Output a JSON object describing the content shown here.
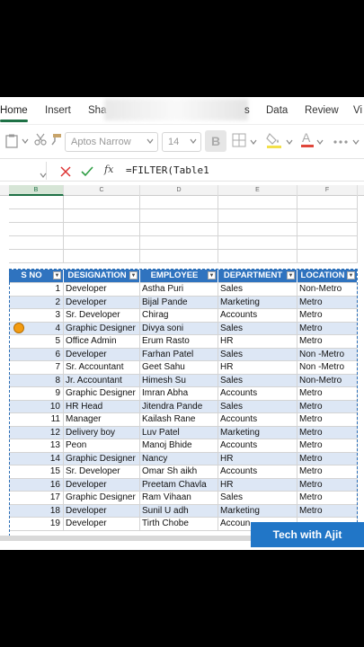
{
  "ribbon": {
    "tabs": [
      {
        "label": "Home",
        "active": true
      },
      {
        "label": "Insert"
      },
      {
        "label": "Sha"
      },
      {
        "label": "s"
      },
      {
        "label": "Data"
      },
      {
        "label": "Review"
      },
      {
        "label": "Vi"
      }
    ]
  },
  "toolbar": {
    "font_name": "Aptos Narrow",
    "font_size": "14",
    "bold_label": "B"
  },
  "formula_bar": {
    "formula": "=FILTER(Table1"
  },
  "grid": {
    "column_letters": [
      "B",
      "C",
      "D",
      "E",
      "F"
    ],
    "headers": [
      "S NO",
      "DESIGNATION",
      "EMPLOYEE",
      "DEPARTMENT",
      "LOCATION"
    ],
    "rows": [
      [
        "1",
        "Developer",
        "Astha Puri",
        "Sales",
        "Non-Metro"
      ],
      [
        "2",
        "Developer",
        "Bijal Pande",
        "Marketing",
        "Metro"
      ],
      [
        "3",
        "Sr. Developer",
        "Chirag",
        "Accounts",
        "Metro"
      ],
      [
        "4",
        "Graphic Designer",
        "Divya soni",
        "Sales",
        "Metro"
      ],
      [
        "5",
        "Office Admin",
        "Erum Rasto",
        "HR",
        "Metro"
      ],
      [
        "6",
        "Developer",
        "Farhan Patel",
        "Sales",
        "Non -Metro"
      ],
      [
        "7",
        "Sr. Accountant",
        "Geet Sahu",
        "HR",
        "Non -Metro"
      ],
      [
        "8",
        "Jr. Accountant",
        "Himesh Su",
        "Sales",
        "Non-Metro"
      ],
      [
        "9",
        "Graphic Designer",
        "Imran Abha",
        "Accounts",
        "Metro"
      ],
      [
        "10",
        "HR Head",
        "Jitendra Pande",
        "Sales",
        "Metro"
      ],
      [
        "11",
        "Manager",
        "Kailash Rane",
        "Accounts",
        "Metro"
      ],
      [
        "12",
        "Delivery boy",
        "Luv Patel",
        "Marketing",
        "Metro"
      ],
      [
        "13",
        "Peon",
        "Manoj Bhide",
        "Accounts",
        "Metro"
      ],
      [
        "14",
        "Graphic Designer",
        "Nancy",
        "HR",
        "Metro"
      ],
      [
        "15",
        "Sr. Developer",
        "Omar Sh aikh",
        "Accounts",
        "Metro"
      ],
      [
        "16",
        "Developer",
        "Preetam Chavla",
        "HR",
        "Metro"
      ],
      [
        "17",
        "Graphic Designer",
        "Ram Vihaan",
        "Sales",
        "Metro"
      ],
      [
        "18",
        "Developer",
        "Sunil U adh",
        "Marketing",
        "Metro"
      ],
      [
        "19",
        "Developer",
        "Tirth Chobe",
        "Accoun",
        ""
      ]
    ]
  },
  "watermark": {
    "text": "Tech with Ajit"
  },
  "colors": {
    "accent": "#1e7145",
    "header_blue": "#2f73bf",
    "band_blue": "#dde7f5"
  }
}
